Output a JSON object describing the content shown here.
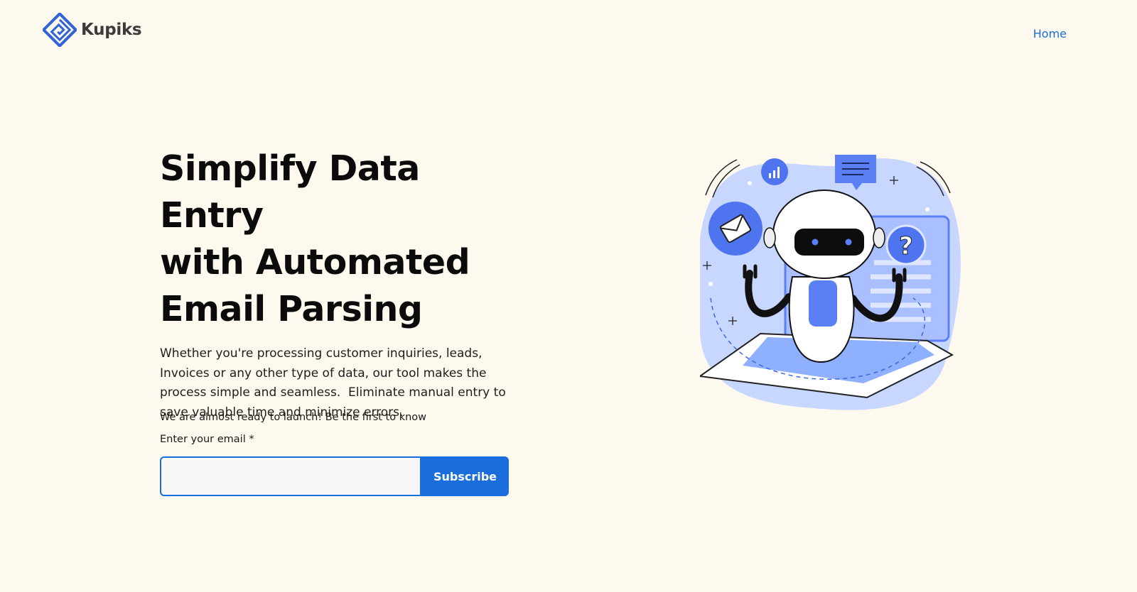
{
  "brand": {
    "name": "Kupiks",
    "color": "#1a6ddb"
  },
  "nav": {
    "home_label": "Home"
  },
  "hero": {
    "title_line1": "Simplify Data Entry",
    "title_line2": "with Automated",
    "title_line3": "Email Parsing",
    "description": "Whether you're processing customer inquiries, leads, Invoices or any other type of data, our tool makes the process simple and seamless.  Eliminate manual entry to save valuable time and minimize errors."
  },
  "signup": {
    "launch_note": "We are almost ready to launch! Be the first to know",
    "email_label": "Enter your email *",
    "email_value": "",
    "email_placeholder": "",
    "subscribe_label": "Subscribe"
  },
  "colors": {
    "background": "#fdf9ee",
    "accent": "#1a6ddb",
    "illustration_blue": "#5b7ff5",
    "illustration_light": "#c8d7ff"
  }
}
